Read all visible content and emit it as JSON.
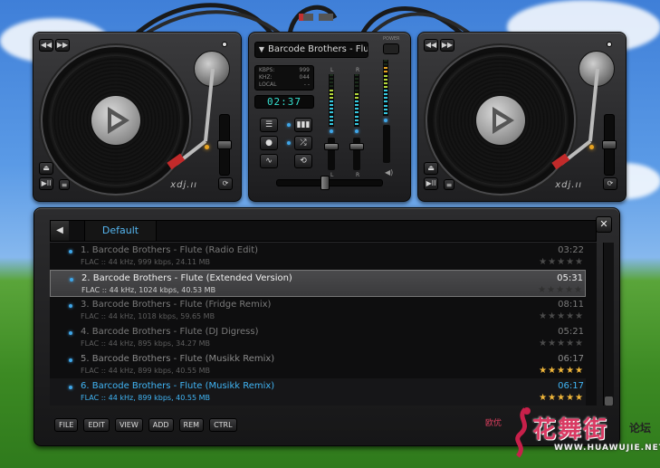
{
  "mixer": {
    "now_playing": "Barcode Brothers - Flute (",
    "power_label": "POWER",
    "info": [
      {
        "key": "KBPS:",
        "value": "999"
      },
      {
        "key": "KHZ:",
        "value": "044"
      },
      {
        "key": "LOCAL",
        "value": "- -"
      }
    ],
    "time": "02:37",
    "left_channel": "L",
    "right_channel": "R",
    "icons": {
      "playlist": "list-icon",
      "record": "record-icon",
      "eq": "equalizer-icon",
      "shuffle": "shuffle-icon",
      "repeat": "repeat-icon",
      "wave": "waveform-icon",
      "speaker": "speaker-icon"
    }
  },
  "decks": {
    "brand": "xdj.ıı",
    "controls": {
      "prev": "◀◀",
      "next": "▶▶",
      "play_pause": "▶II",
      "menu": "≡",
      "eject": "⏏",
      "loop": "⟳"
    }
  },
  "playlist": {
    "tab": "Default",
    "nav_prev": "◀",
    "nav_next": "▶",
    "close": "✕",
    "tracks": [
      {
        "title": "1. Barcode Brothers - Flute (Radio Edit)",
        "meta": "FLAC :: 44 kHz, 999 kbps, 24.11 MB",
        "duration": "03:22",
        "rating": 0
      },
      {
        "title": "2. Barcode Brothers - Flute (Extended Version)",
        "meta": "FLAC :: 44 kHz, 1024 kbps, 40.53 MB",
        "duration": "05:31",
        "rating": 0
      },
      {
        "title": "3. Barcode Brothers - Flute (Fridge Remix)",
        "meta": "FLAC :: 44 kHz, 1018 kbps, 59.65 MB",
        "duration": "08:11",
        "rating": 0
      },
      {
        "title": "4. Barcode Brothers - Flute (DJ Digress)",
        "meta": "FLAC :: 44 kHz, 895 kbps, 34.27 MB",
        "duration": "05:21",
        "rating": 0
      },
      {
        "title": "5. Barcode Brothers - Flute (Musikk Remix)",
        "meta": "FLAC :: 44 kHz, 899 kbps, 40.55 MB",
        "duration": "06:17",
        "rating": 5
      },
      {
        "title": "6. Barcode Brothers - Flute (Musikk Remix)",
        "meta": "FLAC :: 44 kHz, 899 kbps, 40.55 MB",
        "duration": "06:17",
        "rating": 5
      }
    ],
    "stars": "★★★★★",
    "toolbar": [
      "FILE",
      "EDIT",
      "VIEW",
      "ADD",
      "REM",
      "CTRL"
    ]
  },
  "watermark": {
    "small": "欧优",
    "main": "花舞街",
    "side": "论坛",
    "url": "WWW.HUAWUJIE.NET"
  },
  "colors": {
    "accent_blue": "#40b4f4",
    "star_gold": "#f0b63a",
    "led_amber": "#e8a320",
    "clock_cyan": "#35e0d0"
  }
}
